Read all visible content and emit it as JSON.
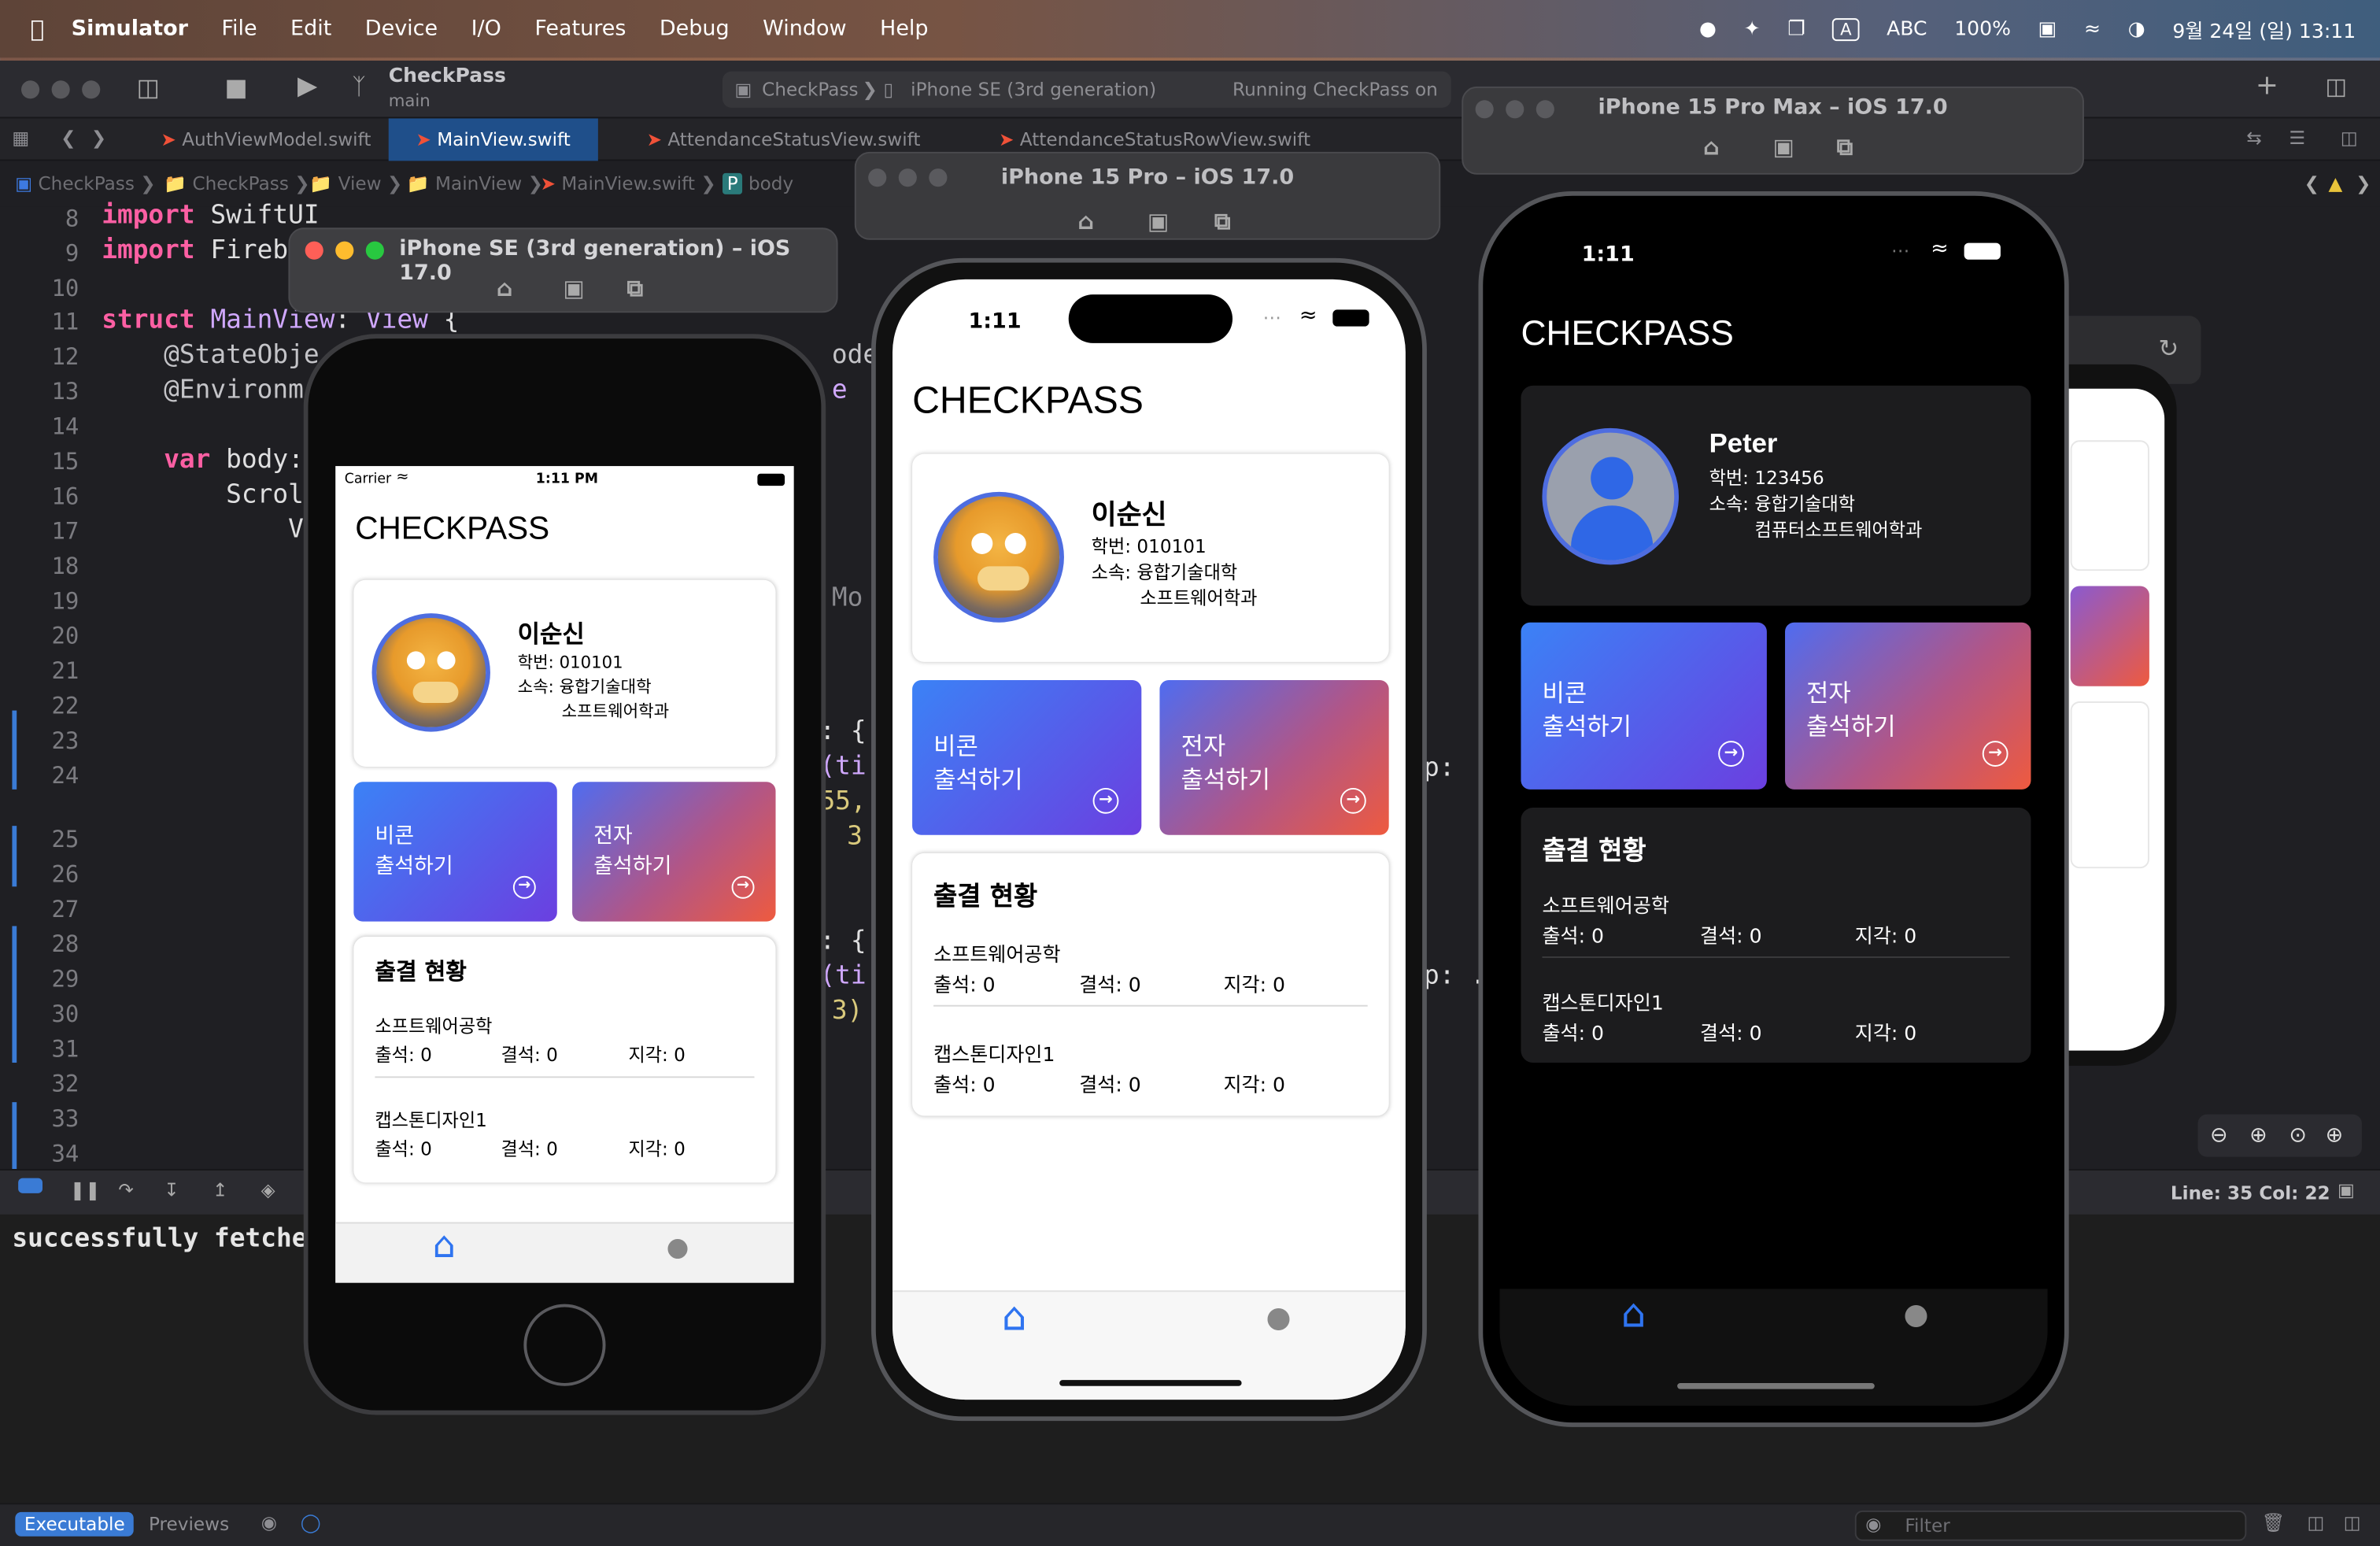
{
  "menubar": {
    "apple": "",
    "app": "Simulator",
    "items": [
      "File",
      "Edit",
      "Device",
      "I/O",
      "Features",
      "Debug",
      "Window",
      "Help"
    ],
    "input_source": "ABC",
    "battery": "100%",
    "datetime": "9월 24일 (일) 13:11"
  },
  "xcode": {
    "scheme": "CheckPass",
    "branch": "main",
    "breadcrumb_target": "CheckPass",
    "device": "iPhone SE (3rd generation)",
    "status": "Running CheckPass on iPhone",
    "tabs": [
      "AuthViewModel.swift",
      "MainView.swift",
      "AttendanceStatusView.swift",
      "AttendanceStatusRowView.swift"
    ],
    "path": [
      "CheckPass",
      "CheckPass",
      "View",
      "MainView",
      "MainView.swift",
      "body"
    ],
    "lines": [
      {
        "n": "8",
        "code": "import SwiftUI"
      },
      {
        "n": "9",
        "code": "import Fireb"
      },
      {
        "n": "10",
        "code": ""
      },
      {
        "n": "11",
        "code": "struct MainView: View {"
      },
      {
        "n": "12",
        "code": "    @StateObje"
      },
      {
        "n": "13",
        "code": "    @Environm"
      },
      {
        "n": "14",
        "code": ""
      },
      {
        "n": "15",
        "code": "    var body:"
      },
      {
        "n": "16",
        "code": "        Scrol"
      },
      {
        "n": "17",
        "code": "            V"
      },
      {
        "n": "18",
        "code": ""
      },
      {
        "n": "19",
        "code": ""
      },
      {
        "n": "20",
        "code": ""
      },
      {
        "n": "21",
        "code": ""
      },
      {
        "n": "22",
        "code": ""
      },
      {
        "n": "23",
        "code": ""
      },
      {
        "n": "24",
        "code": ""
      },
      {
        "n": "25",
        "code": ""
      },
      {
        "n": "26",
        "code": ""
      },
      {
        "n": "27",
        "code": ""
      },
      {
        "n": "28",
        "code": ""
      },
      {
        "n": "29",
        "code": ""
      },
      {
        "n": "30",
        "code": ""
      },
      {
        "n": "31",
        "code": ""
      },
      {
        "n": "32",
        "code": ""
      },
      {
        "n": "33",
        "code": ""
      },
      {
        "n": "34",
        "code": ""
      }
    ],
    "peek": {
      "model": "odel",
      "mo": "Mo",
      "e": "e",
      "a": ": {",
      "b": "(ti",
      "c": "55,",
      "d": "3",
      "e2": ": {",
      "f": "(ti",
      "g": "3)",
      "h": "p:",
      "i": "p: ."
    },
    "console_text": "successfully fetche",
    "line_col": "Line: 35  Col: 22",
    "executable_label": "Executable",
    "previews_label": "Previews",
    "filter_placeholder": "Filter"
  },
  "simulators": {
    "se_title": "iPhone SE (3rd generation) – iOS 17.0",
    "pro_title": "iPhone 15 Pro – iOS 17.0",
    "promax_title": "iPhone 15 Pro Max – iOS 17.0"
  },
  "app": {
    "title": "CHECKPASS",
    "carrier": "Carrier",
    "se_time": "1:11 PM",
    "time": "1:11",
    "user1": {
      "name": "이순신",
      "id": "학번: 010101",
      "affil1": "소속: 융합기술대학",
      "affil2": "소프트웨어학과"
    },
    "user2": {
      "name": "Peter",
      "id": "학번: 123456",
      "affil1": "소속: 융합기술대학",
      "affil2": "컴퓨터소프트웨어학과"
    },
    "btn_beacon": {
      "l1": "비콘",
      "l2": "출석하기"
    },
    "btn_elec": {
      "l1": "전자",
      "l2": "출석하기"
    },
    "status_title": "출결 현황",
    "courses": [
      {
        "name": "소프트웨어공학",
        "present": "출석: 0",
        "absent": "결석: 0",
        "late": "지각: 0"
      },
      {
        "name": "캡스톤디자인1",
        "present": "출석: 0",
        "absent": "결석: 0",
        "late": "지각: 0"
      }
    ]
  },
  "colors": {
    "accent": "#2f74f0",
    "avatar_ring": "#4e6de0",
    "card_dark": "#1c1c1e"
  }
}
